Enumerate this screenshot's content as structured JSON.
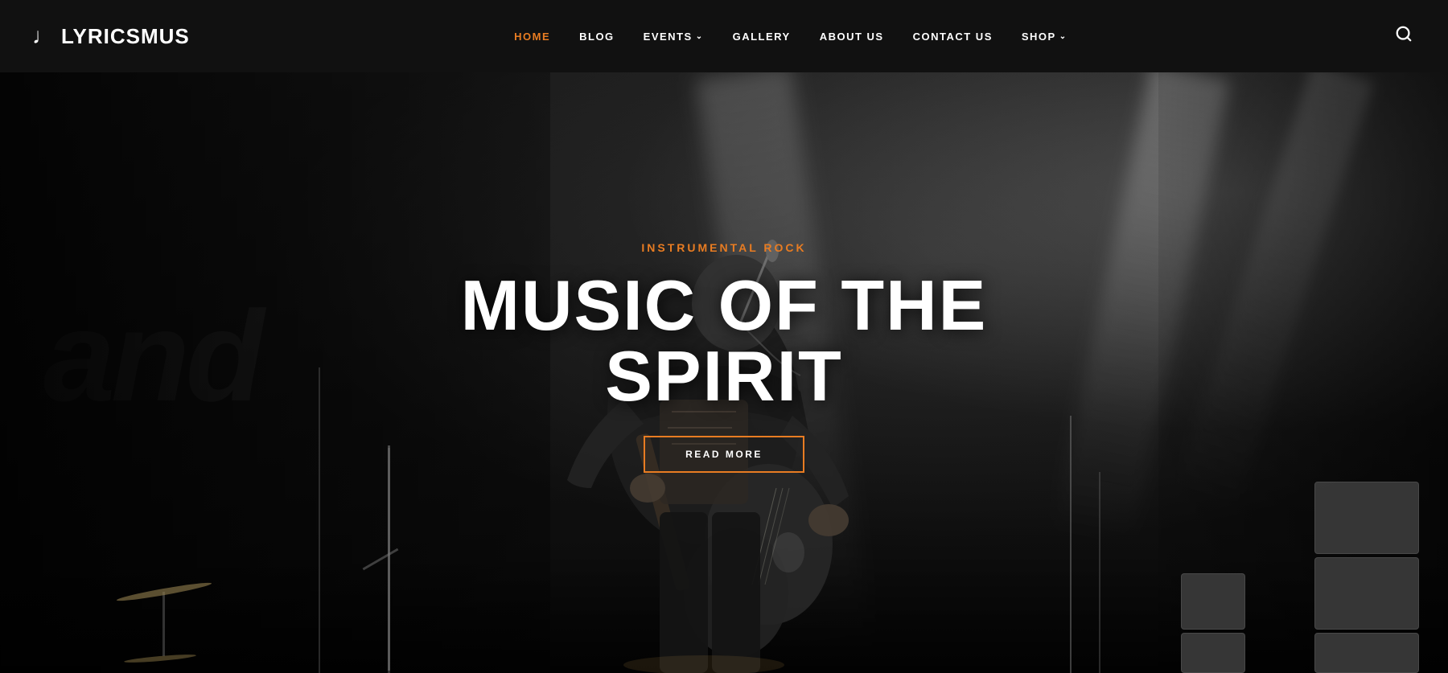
{
  "site": {
    "logo_icon": "♩",
    "logo_text": "LYRICSMUS"
  },
  "nav": {
    "items": [
      {
        "id": "home",
        "label": "HOME",
        "active": true,
        "has_dropdown": false
      },
      {
        "id": "blog",
        "label": "BLOG",
        "active": false,
        "has_dropdown": false
      },
      {
        "id": "events",
        "label": "EVENTS",
        "active": false,
        "has_dropdown": true
      },
      {
        "id": "gallery",
        "label": "GALLERY",
        "active": false,
        "has_dropdown": false
      },
      {
        "id": "about",
        "label": "ABOUT US",
        "active": false,
        "has_dropdown": false
      },
      {
        "id": "contact",
        "label": "CONTACT US",
        "active": false,
        "has_dropdown": false
      },
      {
        "id": "shop",
        "label": "SHOP",
        "active": false,
        "has_dropdown": true
      }
    ],
    "search_label": "search"
  },
  "hero": {
    "genre": "INSTRUMENTAL ROCK",
    "title": "MUSIC OF THE SPIRIT",
    "cta_label": "READ MORE",
    "bg_text": "and"
  },
  "colors": {
    "accent": "#e87c22",
    "nav_bg": "#111111",
    "hero_bg": "#1a1a1a",
    "text_white": "#ffffff"
  }
}
